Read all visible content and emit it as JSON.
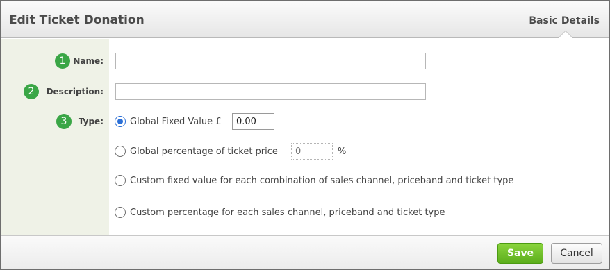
{
  "dialog": {
    "title": "Edit Ticket Donation",
    "tab": "Basic Details"
  },
  "form": {
    "name": {
      "step": "1",
      "label": "Name:",
      "value": ""
    },
    "description": {
      "step": "2",
      "label": "Description:",
      "value": ""
    },
    "type": {
      "step": "3",
      "label": "Type:",
      "selected": "global_fixed",
      "options": {
        "global_fixed": {
          "label": "Global Fixed Value £",
          "value": "0.00"
        },
        "global_percentage": {
          "label": "Global percentage of ticket price",
          "placeholder": "0",
          "suffix": "%"
        },
        "custom_fixed": {
          "label": "Custom fixed value for each combination of sales channel, priceband and ticket type"
        },
        "custom_percentage": {
          "label": "Custom percentage for each sales channel, priceband and ticket type"
        }
      }
    }
  },
  "footer": {
    "save_label": "Save",
    "cancel_label": "Cancel"
  },
  "colors": {
    "step_badge": "#3aa646",
    "save_button": "#6cbf26",
    "label_column": "#eff2e7",
    "radio_selected": "#2b6fd6"
  }
}
